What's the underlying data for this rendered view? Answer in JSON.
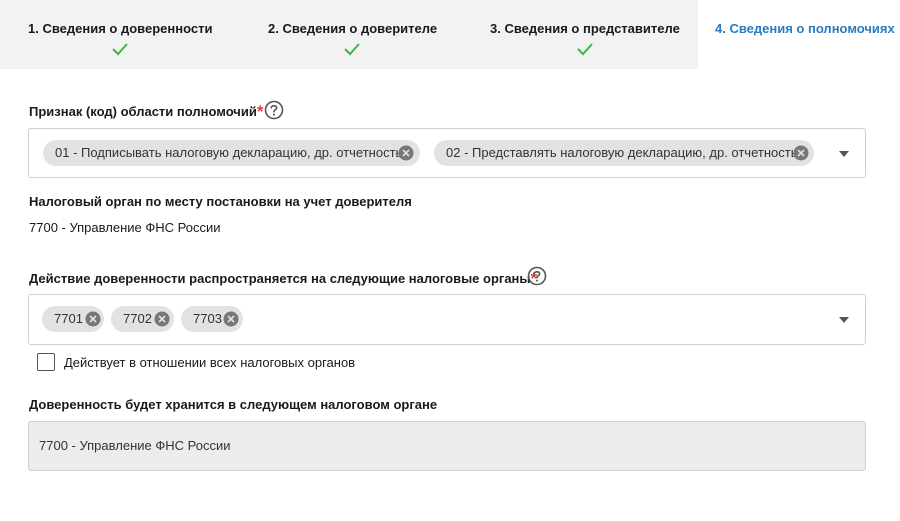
{
  "tabs": [
    {
      "label": "1. Сведения о доверенности",
      "completed": true
    },
    {
      "label": "2. Сведения о доверителе",
      "completed": true
    },
    {
      "label": "3. Сведения о представителе",
      "completed": true
    },
    {
      "label": "4. Сведения о полномочиях",
      "active": true
    }
  ],
  "colors": {
    "active_tab": "#2a7bbf",
    "check": "#3cb54a",
    "required": "#e53935",
    "chip_bg": "#e2e2e2"
  },
  "authority": {
    "label": "Признак (код) области полномочий",
    "required_mark": "*",
    "chips": [
      "01 - Подписывать налоговую декларацию, др. отчетность",
      "02 - Представлять налоговую декларацию, др. отчетность"
    ]
  },
  "tax_authority": {
    "label": "Налоговый орган по месту постановки на учет доверителя",
    "value": "7700 - Управление ФНС России"
  },
  "applies_to": {
    "label": "Действие доверенности распространяется на следующие налоговые органы",
    "required_mark": "*",
    "chips": [
      "7701",
      "7702",
      "7703"
    ],
    "all_checkbox_label": "Действует в отношении всех налоговых органов",
    "all_checked": false
  },
  "storage": {
    "label": "Доверенность будет хранится в следующем налоговом органе",
    "value": "7700 - Управление ФНС России"
  },
  "icons": {
    "check": "check-icon",
    "help": "help-circle-icon",
    "remove": "remove-chip-icon",
    "dropdown": "chevron-down-icon"
  }
}
